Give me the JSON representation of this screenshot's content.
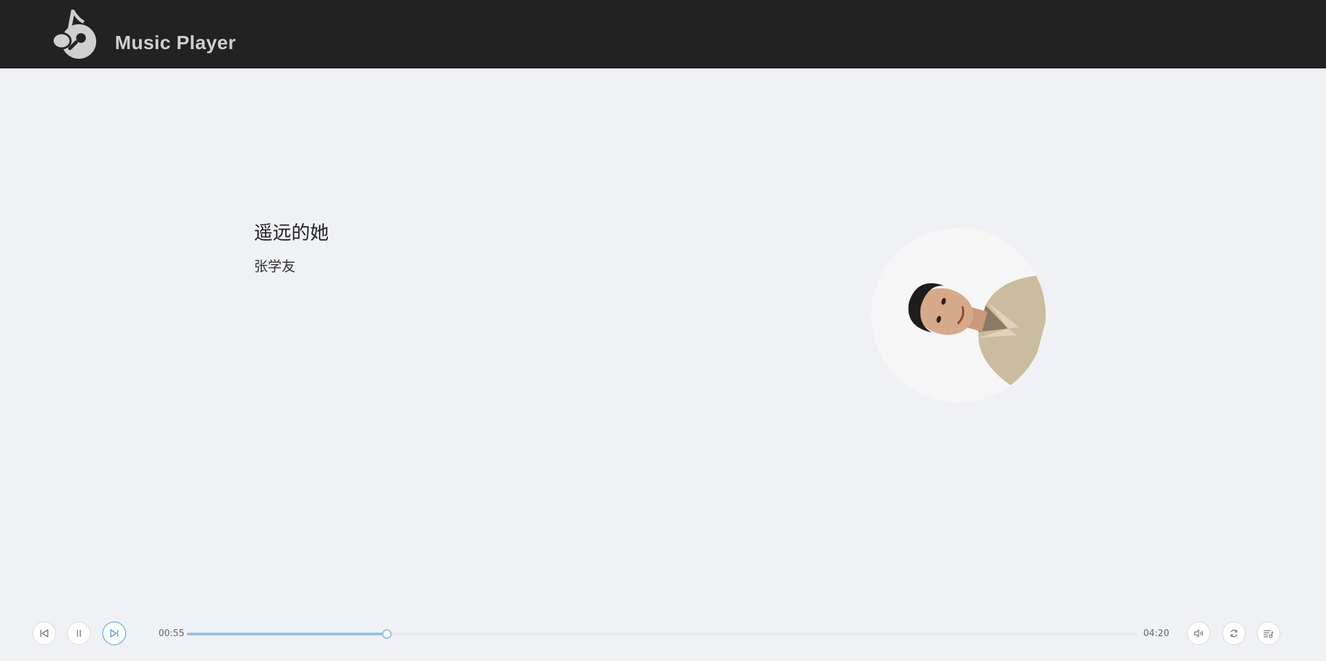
{
  "header": {
    "title": "Music Player",
    "background": "#222222",
    "logo_icon": "music-note-disc-icon"
  },
  "song": {
    "title": "遥远的她",
    "artist": "张学友",
    "cover_icon": "album-cover-artist-photo"
  },
  "player": {
    "current_time": "00:55",
    "total_time": "04:20",
    "progress_fraction": 0.211,
    "accent": "#8fc3e8",
    "controls": {
      "prev_icon": "skip-previous-icon",
      "play_pause_icon": "pause-icon",
      "next_icon": "skip-next-icon",
      "volume_icon": "volume-icon",
      "loop_icon": "loop-icon",
      "playlist_icon": "playlist-icon"
    }
  }
}
